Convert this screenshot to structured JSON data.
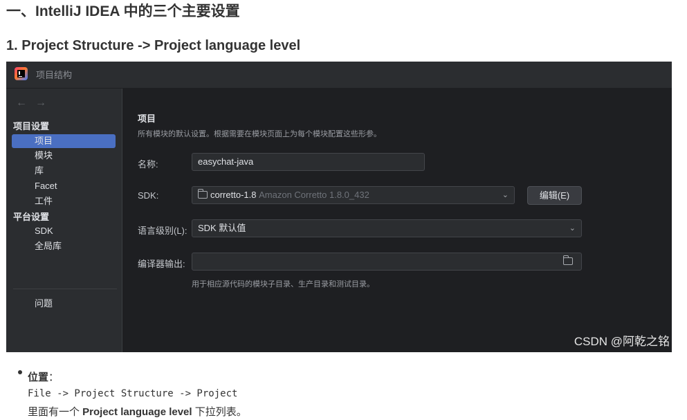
{
  "article": {
    "heading1": "一、IntelliJ IDEA 中的三个主要设置",
    "heading2": "1. Project Structure -> Project language level",
    "bullet_label": "位置",
    "bullet_colon": "：",
    "code": "File -> Project Structure -> Project",
    "text_prefix": "里面有一个 ",
    "text_bold": "Project language level",
    "text_suffix": " 下拉列表。"
  },
  "window": {
    "title": "项目结构",
    "icon": "intellij-idea-icon"
  },
  "sidebar": {
    "back_icon": "←",
    "forward_icon": "→",
    "section_project": "项目设置",
    "section_platform": "平台设置",
    "items": [
      {
        "label": "项目",
        "selected": true
      },
      {
        "label": "模块"
      },
      {
        "label": "库"
      },
      {
        "label": "Facet"
      },
      {
        "label": "工件"
      },
      {
        "label": "SDK"
      },
      {
        "label": "全局库"
      },
      {
        "label": "问题"
      }
    ]
  },
  "main": {
    "section_title": "项目",
    "section_desc": "所有模块的默认设置。根据需要在模块页面上为每个模块配置这些形参。",
    "name_label": "名称:",
    "name_value": "easychat-java",
    "sdk_label": "SDK:",
    "sdk_value": "corretto-1.8",
    "sdk_detail": "Amazon Corretto 1.8.0_432",
    "edit_button": "编辑(E)",
    "lang_label": "语言级别(L):",
    "lang_value": "SDK 默认值",
    "output_label": "编译器输出:",
    "output_value": "",
    "output_hint": "用于相应源代码的模块子目录、生产目录和测试目录。"
  },
  "watermark": "CSDN @阿乾之铭",
  "colors": {
    "ide_bg": "#1e1f22",
    "panel_bg": "#2b2d30",
    "selection": "#4a6fc2",
    "text": "#dfe1e5"
  }
}
